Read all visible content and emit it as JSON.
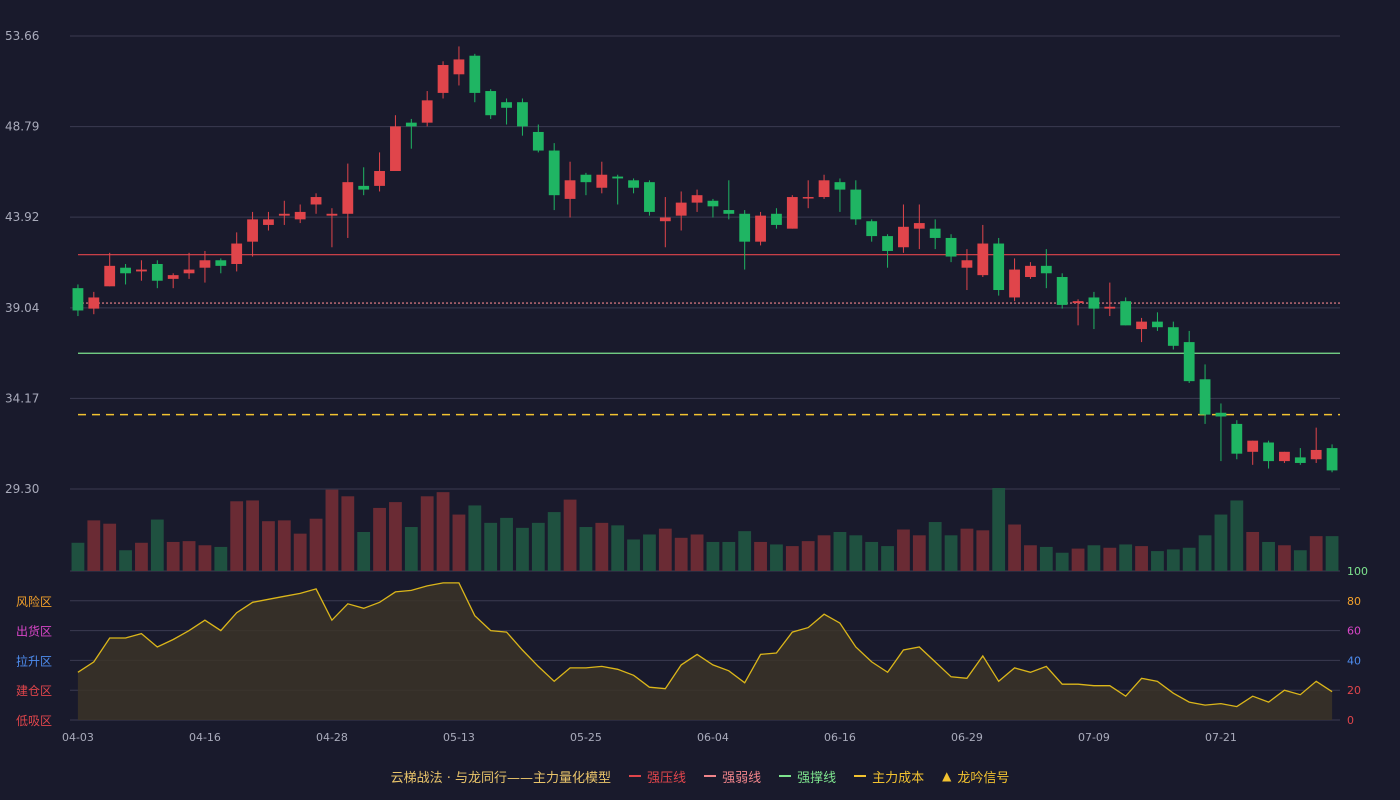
{
  "chart_data": {
    "type": "candlestick",
    "price_axis": {
      "min": 29.3,
      "max": 53.66,
      "ticks": [
        "53.66",
        "48.79",
        "43.92",
        "39.04",
        "34.17",
        "29.30"
      ]
    },
    "date_labels": [
      {
        "label": "04-03",
        "index": 0
      },
      {
        "label": "04-16",
        "index": 8
      },
      {
        "label": "04-28",
        "index": 16
      },
      {
        "label": "05-13",
        "index": 24
      },
      {
        "label": "05-25",
        "index": 32
      },
      {
        "label": "06-04",
        "index": 40
      },
      {
        "label": "06-16",
        "index": 48
      },
      {
        "label": "06-29",
        "index": 56
      },
      {
        "label": "07-09",
        "index": 64
      },
      {
        "label": "07-21",
        "index": 72
      }
    ],
    "candles": [
      [
        40.1,
        38.9,
        40.3,
        38.6
      ],
      [
        39.0,
        39.6,
        39.9,
        38.7
      ],
      [
        40.2,
        41.3,
        42.0,
        40.2
      ],
      [
        41.2,
        40.9,
        41.4,
        40.3
      ],
      [
        41.0,
        41.1,
        41.6,
        40.5
      ],
      [
        41.4,
        40.5,
        41.6,
        40.1
      ],
      [
        40.6,
        40.8,
        40.9,
        40.1
      ],
      [
        40.9,
        41.1,
        42.0,
        40.6
      ],
      [
        41.2,
        41.6,
        42.1,
        40.4
      ],
      [
        41.6,
        41.3,
        41.7,
        40.9
      ],
      [
        41.4,
        42.5,
        43.1,
        41.0
      ],
      [
        42.6,
        43.8,
        44.2,
        41.8
      ],
      [
        43.5,
        43.8,
        44.2,
        43.2
      ],
      [
        44.0,
        44.1,
        44.8,
        43.5
      ],
      [
        43.8,
        44.2,
        44.6,
        43.6
      ],
      [
        44.6,
        45.0,
        45.2,
        44.1
      ],
      [
        44.0,
        44.1,
        44.4,
        42.3
      ],
      [
        44.1,
        45.8,
        46.8,
        42.8
      ],
      [
        45.6,
        45.4,
        46.6,
        45.1
      ],
      [
        45.6,
        46.4,
        47.4,
        45.3
      ],
      [
        46.4,
        48.8,
        49.4,
        46.4
      ],
      [
        49.0,
        48.8,
        49.2,
        47.6
      ],
      [
        49.0,
        50.2,
        50.7,
        48.8
      ],
      [
        50.6,
        52.1,
        52.3,
        50.3
      ],
      [
        51.6,
        52.4,
        53.1,
        51.0
      ],
      [
        52.6,
        50.6,
        52.7,
        50.1
      ],
      [
        50.7,
        49.4,
        50.8,
        49.2
      ],
      [
        50.1,
        49.8,
        50.3,
        48.9
      ],
      [
        50.1,
        48.8,
        50.3,
        48.3
      ],
      [
        48.5,
        47.5,
        48.9,
        47.4
      ],
      [
        47.5,
        45.1,
        47.9,
        44.3
      ],
      [
        44.9,
        45.9,
        46.9,
        43.9
      ],
      [
        46.2,
        45.8,
        46.3,
        45.1
      ],
      [
        45.5,
        46.2,
        46.9,
        45.2
      ],
      [
        46.1,
        46.0,
        46.2,
        44.6
      ],
      [
        45.9,
        45.5,
        46.0,
        45.2
      ],
      [
        45.8,
        44.2,
        45.9,
        44.0
      ],
      [
        43.7,
        43.9,
        45.0,
        42.3
      ],
      [
        44.0,
        44.7,
        45.3,
        43.2
      ],
      [
        44.7,
        45.1,
        45.4,
        44.2
      ],
      [
        44.8,
        44.5,
        44.9,
        43.9
      ],
      [
        44.3,
        44.1,
        45.9,
        43.8
      ],
      [
        44.1,
        42.6,
        44.3,
        41.1
      ],
      [
        42.6,
        44.0,
        44.2,
        42.4
      ],
      [
        44.1,
        43.5,
        44.4,
        43.3
      ],
      [
        43.3,
        45.0,
        45.1,
        43.3
      ],
      [
        45.0,
        45.0,
        45.9,
        44.4
      ],
      [
        45.0,
        45.9,
        46.2,
        44.9
      ],
      [
        45.8,
        45.4,
        46.0,
        44.2
      ],
      [
        45.4,
        43.8,
        45.9,
        43.5
      ],
      [
        43.7,
        42.9,
        43.8,
        42.6
      ],
      [
        42.9,
        42.1,
        43.0,
        41.2
      ],
      [
        42.3,
        43.4,
        44.6,
        42.0
      ],
      [
        43.3,
        43.6,
        44.6,
        42.2
      ],
      [
        43.3,
        42.8,
        43.8,
        42.2
      ],
      [
        42.8,
        41.8,
        43.0,
        41.5
      ],
      [
        41.2,
        41.6,
        42.2,
        40.0
      ],
      [
        40.8,
        42.5,
        43.5,
        40.7
      ],
      [
        42.5,
        40.0,
        42.8,
        39.7
      ],
      [
        39.6,
        41.1,
        41.7,
        39.4
      ],
      [
        40.7,
        41.3,
        41.5,
        40.6
      ],
      [
        41.3,
        40.9,
        42.2,
        40.1
      ],
      [
        40.7,
        39.2,
        40.9,
        39.0
      ],
      [
        39.3,
        39.4,
        39.5,
        38.1
      ],
      [
        39.6,
        39.0,
        39.9,
        37.9
      ],
      [
        39.0,
        39.1,
        40.4,
        38.6
      ],
      [
        39.4,
        38.1,
        39.6,
        38.1
      ],
      [
        37.9,
        38.3,
        38.5,
        37.2
      ],
      [
        38.3,
        38.0,
        38.8,
        37.8
      ],
      [
        38.0,
        37.0,
        38.3,
        36.8
      ],
      [
        37.2,
        35.1,
        37.8,
        35.0
      ],
      [
        35.2,
        33.3,
        36.0,
        32.8
      ],
      [
        33.4,
        33.2,
        33.9,
        30.8
      ],
      [
        32.8,
        31.2,
        33.0,
        30.9
      ],
      [
        31.3,
        31.9,
        31.9,
        30.6
      ],
      [
        31.8,
        30.8,
        31.9,
        30.4
      ],
      [
        30.8,
        31.3,
        31.3,
        30.7
      ],
      [
        31.0,
        30.7,
        31.5,
        30.6
      ],
      [
        30.9,
        31.4,
        32.6,
        30.7
      ],
      [
        31.5,
        30.3,
        31.7,
        30.2
      ]
    ],
    "volumes": [
      0.34,
      0.61,
      0.57,
      0.25,
      0.34,
      0.62,
      0.35,
      0.36,
      0.31,
      0.29,
      0.84,
      0.85,
      0.6,
      0.61,
      0.45,
      0.63,
      0.98,
      0.9,
      0.47,
      0.76,
      0.83,
      0.53,
      0.9,
      0.95,
      0.68,
      0.79,
      0.58,
      0.64,
      0.52,
      0.58,
      0.71,
      0.86,
      0.53,
      0.58,
      0.55,
      0.38,
      0.44,
      0.51,
      0.4,
      0.44,
      0.35,
      0.35,
      0.48,
      0.35,
      0.32,
      0.3,
      0.36,
      0.43,
      0.47,
      0.43,
      0.35,
      0.3,
      0.5,
      0.43,
      0.59,
      0.43,
      0.51,
      0.49,
      1.0,
      0.56,
      0.31,
      0.29,
      0.22,
      0.27,
      0.31,
      0.28,
      0.32,
      0.3,
      0.24,
      0.26,
      0.28,
      0.43,
      0.68,
      0.85,
      0.47,
      0.35,
      0.31,
      0.25,
      0.42,
      0.42
    ],
    "horizontal_lines": [
      {
        "name": "强压线",
        "value": 41.9,
        "color": "#e0454b",
        "style": "solid"
      },
      {
        "name": "强弱线",
        "value": 39.3,
        "color": "#f0848a",
        "style": "dotted"
      },
      {
        "name": "强撑线",
        "value": 36.6,
        "color": "#7de38e",
        "style": "solid"
      },
      {
        "name": "主力成本",
        "value": 33.3,
        "color": "#f2c230",
        "style": "dashed"
      }
    ],
    "indicator": {
      "axis_ticks": [
        "100",
        "80",
        "60",
        "40",
        "20",
        "0"
      ],
      "zones": [
        "风险区",
        "出货区",
        "拉升区",
        "建仓区",
        "低吸区"
      ],
      "values": [
        32,
        39,
        55,
        55,
        58,
        49,
        54,
        60,
        67,
        60,
        72,
        79,
        81,
        83,
        85,
        88,
        67,
        78,
        75,
        79,
        86,
        87,
        90,
        92,
        92,
        70,
        60,
        59,
        47,
        36,
        26,
        35,
        35,
        36,
        34,
        30,
        22,
        21,
        37,
        44,
        37,
        33,
        25,
        44,
        45,
        59,
        62,
        71,
        65,
        49,
        39,
        32,
        47,
        49,
        39,
        29,
        28,
        43,
        26,
        35,
        32,
        36,
        24,
        24,
        23,
        23,
        16,
        28,
        26,
        18,
        12,
        10,
        11,
        9,
        16,
        12,
        20,
        17,
        26,
        19
      ]
    },
    "colors": {
      "up": "#e0454b",
      "down": "#1fb563",
      "vol_up": "#6a2b34",
      "vol_down": "#1f5140",
      "indicator_line": "#dbb61a"
    }
  },
  "legend": {
    "title": "云梯战法 · 与龙同行——主力量化模型",
    "items": [
      {
        "label": "强压线",
        "color": "#e0454b",
        "kind": "solid"
      },
      {
        "label": "强弱线",
        "color": "#f0848a",
        "kind": "dash"
      },
      {
        "label": "强撑线",
        "color": "#7de38e",
        "kind": "solid"
      },
      {
        "label": "主力成本",
        "color": "#f2c230",
        "kind": "dash"
      },
      {
        "label": "龙吟信号",
        "color": "#f2c230",
        "kind": "triangle",
        "glyph": "▲"
      }
    ]
  }
}
